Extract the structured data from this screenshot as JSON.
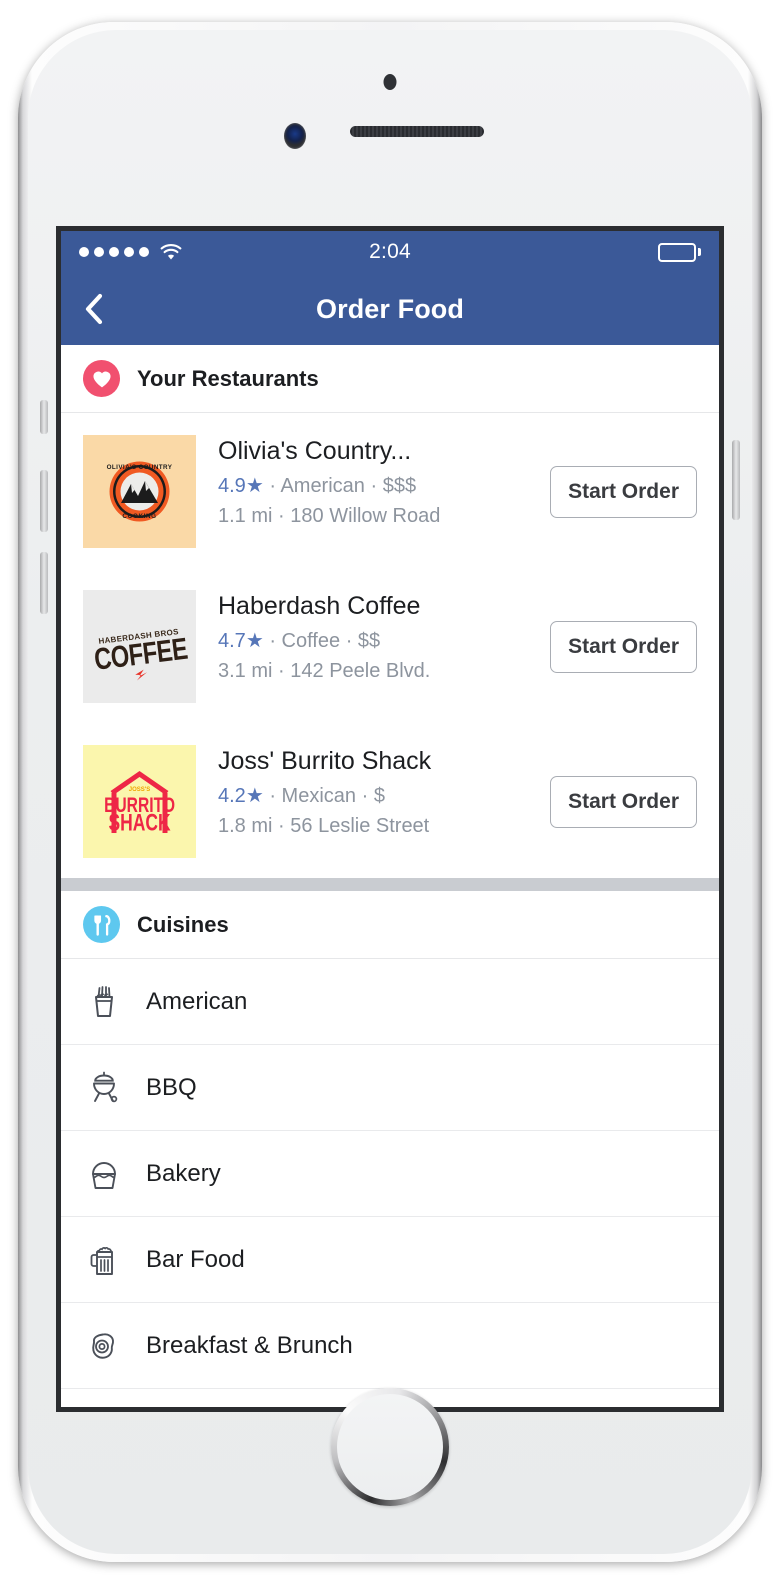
{
  "device": {
    "type": "smartphone",
    "color": "white"
  },
  "status_bar": {
    "time": "2:04",
    "signal_dots": 5,
    "wifi_icon": "wifi-icon",
    "battery_icon": "battery-full-icon",
    "background_color": "#3b5998"
  },
  "nav_bar": {
    "back_icon": "chevron-left-icon",
    "title": "Order Food",
    "background_color": "#3b5998",
    "text_color": "#ffffff"
  },
  "sections": {
    "restaurants": {
      "icon": "heart-icon",
      "icon_color": "#f1506f",
      "title": "Your Restaurants",
      "items": [
        {
          "name": "Olivia's Country...",
          "rating": "4.9",
          "star_icon": "star-icon",
          "cuisine": "American",
          "price": "$$$",
          "distance": "1.1 mi",
          "address": "180 Willow Road",
          "meta_separator": "·",
          "action_label": "Start Order",
          "logo": {
            "style": "circle-badge",
            "background": "#fad9a7",
            "top_text": "OLIVIA'S COUNTRY",
            "bottom_text": "COOKING",
            "accent_color": "#f05a22",
            "art": "mountains"
          }
        },
        {
          "name": "Haberdash Coffee",
          "rating": "4.7",
          "star_icon": "star-icon",
          "cuisine": "Coffee",
          "price": "$$",
          "distance": "3.1 mi",
          "address": "142 Peele Blvd.",
          "meta_separator": "·",
          "action_label": "Start Order",
          "logo": {
            "style": "wordmark",
            "background": "#ebebeb",
            "top_text": "HABERDASH BROS",
            "bottom_text": "COFFEE",
            "accent_color": "#e8332a",
            "art": "lightning-bolt"
          }
        },
        {
          "name": "Joss' Burrito Shack",
          "rating": "4.2",
          "star_icon": "star-icon",
          "cuisine": "Mexican",
          "price": "$",
          "distance": "1.8 mi",
          "address": "56 Leslie Street",
          "meta_separator": "·",
          "action_label": "Start Order",
          "logo": {
            "style": "shack",
            "background": "#fbf6ad",
            "top_text": "JOSS'S",
            "line1": "BURRITO",
            "line2": "SHACK",
            "accent_color": "#ee2646",
            "art": "house-roof"
          }
        }
      ]
    },
    "cuisines": {
      "icon": "fork-knife-icon",
      "icon_color": "#5ec8ef",
      "title": "Cuisines",
      "items": [
        {
          "label": "American",
          "icon": "french-fries-icon"
        },
        {
          "label": "BBQ",
          "icon": "grill-icon"
        },
        {
          "label": "Bakery",
          "icon": "cupcake-icon"
        },
        {
          "label": "Bar Food",
          "icon": "beer-mug-icon"
        },
        {
          "label": "Breakfast & Brunch",
          "icon": "fried-egg-icon"
        }
      ]
    }
  },
  "colors": {
    "brand_blue": "#3b5998",
    "rating_blue": "#5676b8",
    "meta_gray": "#8d949e",
    "divider_gray": "#c9ccd1"
  }
}
